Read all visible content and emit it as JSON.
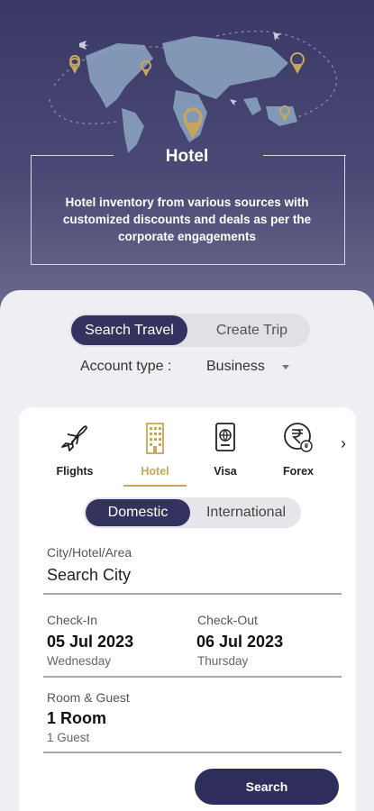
{
  "hero": {
    "title": "Hotel",
    "description": "Hotel inventory from various sources with customized discounts and deals as per the  corporate engagements"
  },
  "mode_toggle": {
    "active": "Search Travel",
    "inactive": "Create Trip"
  },
  "account": {
    "label": "Account type :",
    "value": "Business"
  },
  "categories": [
    {
      "label": "Flights",
      "icon": "plane-icon"
    },
    {
      "label": "Hotel",
      "icon": "hotel-building-icon",
      "selected": true
    },
    {
      "label": "Visa",
      "icon": "passport-icon"
    },
    {
      "label": "Forex",
      "icon": "rupee-coin-icon"
    }
  ],
  "scope_toggle": {
    "active": "Domestic",
    "inactive": "International"
  },
  "city": {
    "label": "City/Hotel/Area",
    "placeholder": "Search City"
  },
  "checkin": {
    "label": "Check-In",
    "date": "05 Jul 2023",
    "day": "Wednesday"
  },
  "checkout": {
    "label": "Check-Out",
    "date": "06 Jul 2023",
    "day": "Thursday"
  },
  "room_guest": {
    "label": "Room & Guest",
    "rooms": "1 Room",
    "guests": "1 Guest"
  },
  "search_button": "Search",
  "colors": {
    "brand_navy": "#34325f",
    "accent_gold": "#c5a65c"
  }
}
